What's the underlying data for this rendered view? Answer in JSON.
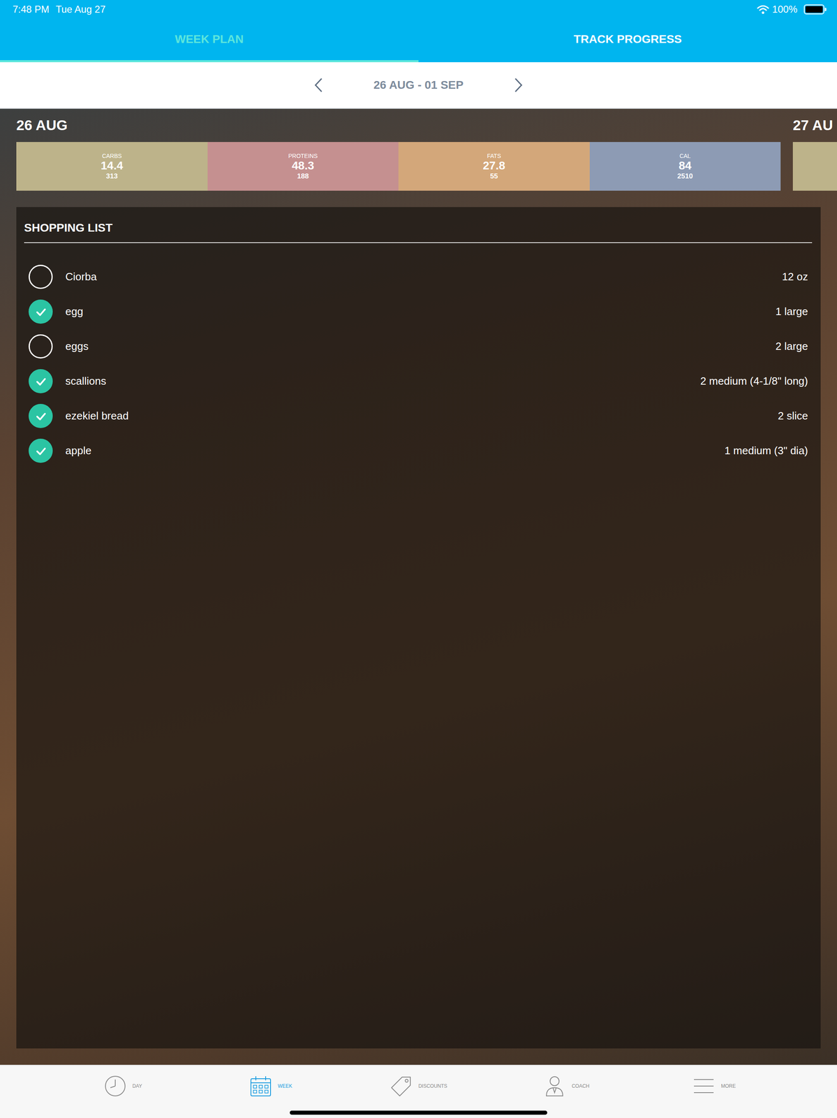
{
  "status_bar": {
    "time": "7:48 PM",
    "date": "Tue Aug 27",
    "battery": {
      "text": "100%",
      "level": 1
    }
  },
  "tabs": [
    {
      "label": "WEEK PLAN",
      "selected": true
    },
    {
      "label": "TRACK PROGRESS",
      "selected": false
    }
  ],
  "week": {
    "range": "26 AUG - 01 SEP"
  },
  "days": [
    {
      "date": "26 AUG",
      "macros": [
        {
          "label": "CARBS",
          "value": "14.4",
          "target": "313",
          "color": "#bdb38a"
        },
        {
          "label": "PROTEINS",
          "value": "48.3",
          "target": "188",
          "color": "#c59090"
        },
        {
          "label": "FATS",
          "value": "27.8",
          "target": "55",
          "color": "#d3a77a"
        },
        {
          "label": "CAL",
          "value": "84",
          "target": "2510",
          "color": "#8d9bb4"
        }
      ],
      "shopping_list": {
        "title": "SHOPPING LIST",
        "items": [
          {
            "name": "Ciorba",
            "amount": "12 oz",
            "checked": false
          },
          {
            "name": "egg",
            "amount": "1 large",
            "checked": true
          },
          {
            "name": "eggs",
            "amount": "2 large",
            "checked": false
          },
          {
            "name": "scallions",
            "amount": "2 medium (4-1/8\" long)",
            "checked": true
          },
          {
            "name": "ezekiel bread",
            "amount": "2 slice",
            "checked": true
          },
          {
            "name": "apple",
            "amount": "1 medium (3\" dia)",
            "checked": true
          }
        ]
      }
    },
    {
      "date": "27 AU"
    }
  ],
  "bottom_nav": [
    {
      "label": "DAY",
      "selected": false
    },
    {
      "label": "WEEK",
      "selected": true
    },
    {
      "label": "DISCOUNTS",
      "selected": false
    },
    {
      "label": "COACH",
      "selected": false
    },
    {
      "label": "MORE",
      "selected": false
    }
  ]
}
